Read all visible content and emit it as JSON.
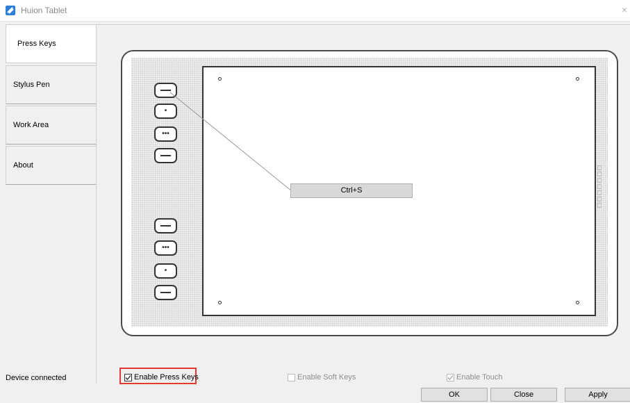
{
  "window": {
    "title": "Huion Tablet",
    "close_glyph": "×",
    "icon": "huion-logo-icon"
  },
  "tabs": [
    {
      "label": "Press Keys",
      "active": true
    },
    {
      "label": "Stylus Pen",
      "active": false
    },
    {
      "label": "Work Area",
      "active": false
    },
    {
      "label": "About",
      "active": false
    }
  ],
  "express_keys": {
    "top": [
      "dash",
      "dot",
      "ellipsis",
      "dash"
    ],
    "bottom": [
      "dash",
      "ellipsis",
      "dot",
      "dash"
    ],
    "glyphs": {
      "dot": "•",
      "ellipsis": "•••"
    }
  },
  "selected_key_shortcut": "Ctrl+S",
  "status": "Device connected",
  "options": {
    "enable_press_keys": {
      "label": "Enable Press Keys",
      "checked": true,
      "disabled": false
    },
    "enable_soft_keys": {
      "label": "Enable Soft Keys",
      "checked": false,
      "disabled": true
    },
    "enable_touch": {
      "label": "Enable Touch",
      "checked": true,
      "disabled": true
    }
  },
  "buttons": {
    "ok": "OK",
    "close": "Close",
    "apply": "Apply"
  },
  "colors": {
    "highlight": "#e53935",
    "accent": "#2d7fd8"
  }
}
